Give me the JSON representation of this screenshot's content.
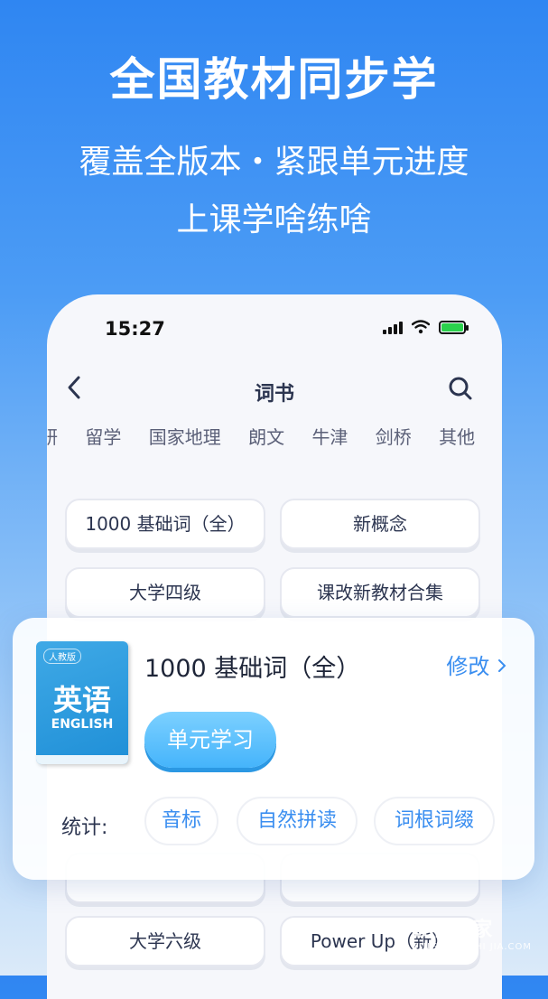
{
  "promo": {
    "title": "全国教材同步学",
    "line1": "覆盖全版本・紧跟单元进度",
    "line2": "上课学啥练啥"
  },
  "status_bar": {
    "time": "15:27"
  },
  "nav": {
    "title": "词书",
    "back_icon": "chevron-left-icon",
    "search_icon": "search-icon"
  },
  "categories": [
    "研",
    "留学",
    "国家地理",
    "朗文",
    "牛津",
    "剑桥",
    "其他"
  ],
  "books": [
    "1000 基础词（全）",
    "新概念",
    "大学四级",
    "课改新教材合集",
    "大学六级",
    "Power Up（新）"
  ],
  "current_book": {
    "cover_tag": "人教版",
    "cover_title": "英语",
    "cover_subtitle": "ENGLISH",
    "name": "1000 基础词（全）",
    "modify_label": "修改",
    "study_label": "单元学习"
  },
  "stats": {
    "label": "统计:",
    "items": [
      "音标",
      "自然拼读",
      "词根词缀"
    ]
  },
  "watermark": {
    "cn": "硬件之家",
    "py": "YING JIAN ZHI JIA.COM"
  },
  "colors": {
    "accent": "#3a8ef0",
    "bg_top": "#2f86f2",
    "study_button": "#45b4fb"
  }
}
